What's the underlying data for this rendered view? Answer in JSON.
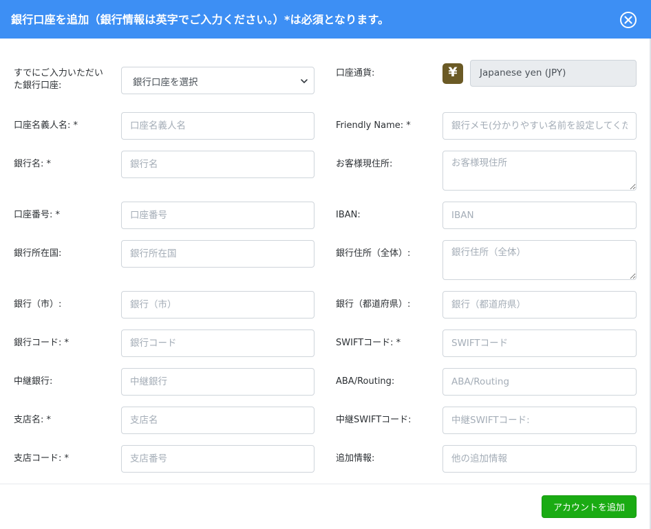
{
  "header": {
    "title": "銀行口座を追加（銀行情報は英字でご入力ください。）*は必須となります。",
    "close_icon": "close-circle-icon"
  },
  "colors": {
    "header_bg": "#3d8ff4",
    "submit_bg": "#1aab13",
    "currency_icon_bg": "#6b5a25"
  },
  "form": {
    "existing_account": {
      "label": "すでにご入力いただいた銀行口座:",
      "selected": "銀行口座を選択"
    },
    "currency": {
      "label": "口座通貨:",
      "icon": "yen-icon",
      "glyph": "¥",
      "value": "Japanese yen (JPY)"
    },
    "account_holder": {
      "label": "口座名義人名: *",
      "placeholder": "口座名義人名"
    },
    "friendly_name": {
      "label": "Friendly Name: *",
      "placeholder": "銀行メモ(分かりやすい名前を設定してください)"
    },
    "bank_name": {
      "label": "銀行名: *",
      "placeholder": "銀行名"
    },
    "customer_address": {
      "label": "お客様現住所:",
      "placeholder": "お客様現住所"
    },
    "account_number": {
      "label": "口座番号: *",
      "placeholder": "口座番号"
    },
    "iban": {
      "label": "IBAN:",
      "placeholder": "IBAN"
    },
    "bank_country": {
      "label": "銀行所在国:",
      "placeholder": "銀行所在国"
    },
    "bank_address": {
      "label": "銀行住所（全体）:",
      "placeholder": "銀行住所（全体）"
    },
    "bank_city": {
      "label": "銀行（市）:",
      "placeholder": "銀行（市）"
    },
    "bank_prefecture": {
      "label": "銀行（都道府県）:",
      "placeholder": "銀行（都道府県）"
    },
    "bank_code": {
      "label": "銀行コード: *",
      "placeholder": "銀行コード"
    },
    "swift_code": {
      "label": "SWIFTコード: *",
      "placeholder": "SWIFTコード"
    },
    "intermediary_bank": {
      "label": "中継銀行:",
      "placeholder": "中継銀行"
    },
    "aba_routing": {
      "label": "ABA/Routing:",
      "placeholder": "ABA/Routing"
    },
    "branch_name": {
      "label": "支店名: *",
      "placeholder": "支店名"
    },
    "intermediary_swift": {
      "label": "中継SWIFTコード:",
      "placeholder": "中継SWIFTコード:"
    },
    "branch_code": {
      "label": "支店コード: *",
      "placeholder": "支店番号"
    },
    "additional_info": {
      "label": "追加情報:",
      "placeholder": "他の追加情報"
    }
  },
  "footer": {
    "submit_label": "アカウントを追加"
  }
}
